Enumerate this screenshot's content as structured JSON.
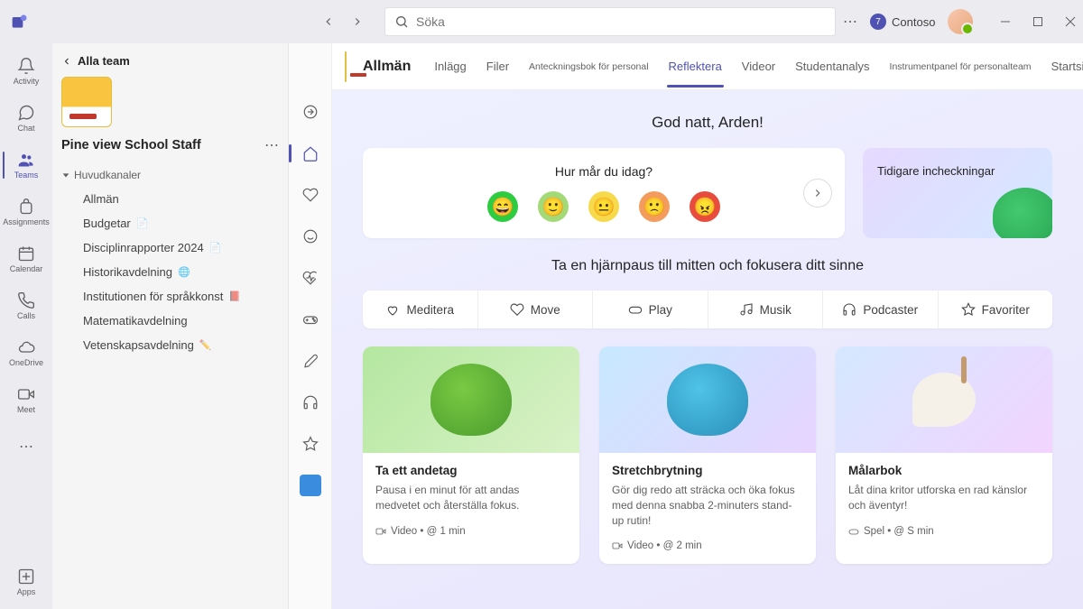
{
  "titlebar": {
    "search_placeholder": "Söka",
    "org_name": "Contoso",
    "notification_count": "7"
  },
  "rail": {
    "activity": "Activity",
    "chat": "Chat",
    "teams": "Teams",
    "assignments": "Assignments",
    "calendar": "Calendar",
    "calls": "Calls",
    "onedrive": "OneDrive",
    "meet": "Meet",
    "apps": "Apps"
  },
  "panel": {
    "back_label": "Alla team",
    "team_name": "Pine view School Staff",
    "section": "Huvudkanaler",
    "channels": [
      "Allmän",
      "Budgetar",
      "Disciplinrapporter 2024",
      "Historikavdelning",
      "Institutionen för språkkonst",
      "Matematikavdelning",
      "Vetenskapsavdelning"
    ]
  },
  "tabs": {
    "channel": "Allmän",
    "items": [
      "Inlägg",
      "Filer",
      "Anteckningsbok för personal",
      "Reflektera",
      "Videor",
      "Studentanalys",
      "Instrumentpanel för personalteam",
      "Startsida"
    ]
  },
  "reflect": {
    "greeting": "God natt, Arden!",
    "checkin_q": "Hur mår du idag?",
    "prev_label": "Tidigare incheckningar",
    "brain_h": "Ta en hjärnpaus till mitten och fokusera ditt sinne",
    "cats": [
      "Meditera",
      "Move",
      "Play",
      "Musik",
      "Podcaster",
      "Favoriter"
    ],
    "cards": [
      {
        "title": "Ta ett andetag",
        "desc": "Pausa i en minut för att andas medvetet och återställa fokus.",
        "meta": "Video • @ 1 min"
      },
      {
        "title": "Stretchbrytning",
        "desc": "Gör dig redo att sträcka och öka fokus med denna snabba 2-minuters stand-up rutin!",
        "meta": "Video • @ 2 min"
      },
      {
        "title": "Målarbok",
        "desc": "Låt dina kritor utforska en rad känslor och äventyr!",
        "meta": "Spel • @     S min"
      }
    ]
  }
}
